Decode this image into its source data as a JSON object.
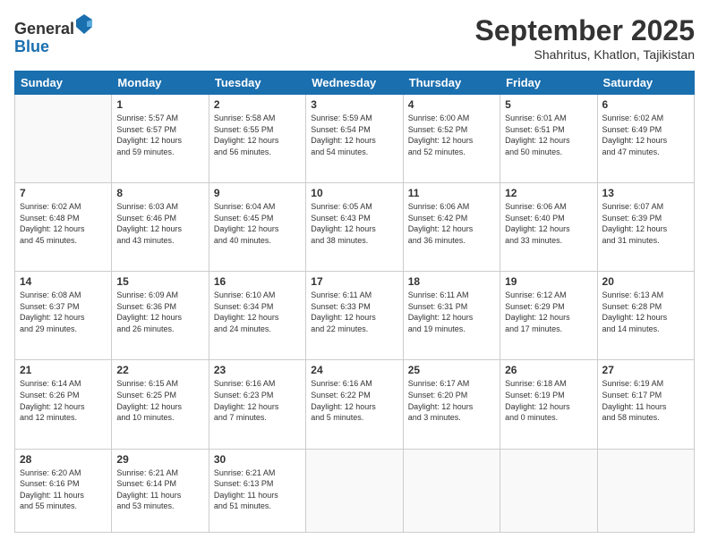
{
  "header": {
    "logo_line1": "General",
    "logo_line2": "Blue",
    "month": "September 2025",
    "location": "Shahritus, Khatlon, Tajikistan"
  },
  "weekdays": [
    "Sunday",
    "Monday",
    "Tuesday",
    "Wednesday",
    "Thursday",
    "Friday",
    "Saturday"
  ],
  "weeks": [
    [
      {
        "day": "",
        "info": ""
      },
      {
        "day": "1",
        "info": "Sunrise: 5:57 AM\nSunset: 6:57 PM\nDaylight: 12 hours\nand 59 minutes."
      },
      {
        "day": "2",
        "info": "Sunrise: 5:58 AM\nSunset: 6:55 PM\nDaylight: 12 hours\nand 56 minutes."
      },
      {
        "day": "3",
        "info": "Sunrise: 5:59 AM\nSunset: 6:54 PM\nDaylight: 12 hours\nand 54 minutes."
      },
      {
        "day": "4",
        "info": "Sunrise: 6:00 AM\nSunset: 6:52 PM\nDaylight: 12 hours\nand 52 minutes."
      },
      {
        "day": "5",
        "info": "Sunrise: 6:01 AM\nSunset: 6:51 PM\nDaylight: 12 hours\nand 50 minutes."
      },
      {
        "day": "6",
        "info": "Sunrise: 6:02 AM\nSunset: 6:49 PM\nDaylight: 12 hours\nand 47 minutes."
      }
    ],
    [
      {
        "day": "7",
        "info": "Sunrise: 6:02 AM\nSunset: 6:48 PM\nDaylight: 12 hours\nand 45 minutes."
      },
      {
        "day": "8",
        "info": "Sunrise: 6:03 AM\nSunset: 6:46 PM\nDaylight: 12 hours\nand 43 minutes."
      },
      {
        "day": "9",
        "info": "Sunrise: 6:04 AM\nSunset: 6:45 PM\nDaylight: 12 hours\nand 40 minutes."
      },
      {
        "day": "10",
        "info": "Sunrise: 6:05 AM\nSunset: 6:43 PM\nDaylight: 12 hours\nand 38 minutes."
      },
      {
        "day": "11",
        "info": "Sunrise: 6:06 AM\nSunset: 6:42 PM\nDaylight: 12 hours\nand 36 minutes."
      },
      {
        "day": "12",
        "info": "Sunrise: 6:06 AM\nSunset: 6:40 PM\nDaylight: 12 hours\nand 33 minutes."
      },
      {
        "day": "13",
        "info": "Sunrise: 6:07 AM\nSunset: 6:39 PM\nDaylight: 12 hours\nand 31 minutes."
      }
    ],
    [
      {
        "day": "14",
        "info": "Sunrise: 6:08 AM\nSunset: 6:37 PM\nDaylight: 12 hours\nand 29 minutes."
      },
      {
        "day": "15",
        "info": "Sunrise: 6:09 AM\nSunset: 6:36 PM\nDaylight: 12 hours\nand 26 minutes."
      },
      {
        "day": "16",
        "info": "Sunrise: 6:10 AM\nSunset: 6:34 PM\nDaylight: 12 hours\nand 24 minutes."
      },
      {
        "day": "17",
        "info": "Sunrise: 6:11 AM\nSunset: 6:33 PM\nDaylight: 12 hours\nand 22 minutes."
      },
      {
        "day": "18",
        "info": "Sunrise: 6:11 AM\nSunset: 6:31 PM\nDaylight: 12 hours\nand 19 minutes."
      },
      {
        "day": "19",
        "info": "Sunrise: 6:12 AM\nSunset: 6:29 PM\nDaylight: 12 hours\nand 17 minutes."
      },
      {
        "day": "20",
        "info": "Sunrise: 6:13 AM\nSunset: 6:28 PM\nDaylight: 12 hours\nand 14 minutes."
      }
    ],
    [
      {
        "day": "21",
        "info": "Sunrise: 6:14 AM\nSunset: 6:26 PM\nDaylight: 12 hours\nand 12 minutes."
      },
      {
        "day": "22",
        "info": "Sunrise: 6:15 AM\nSunset: 6:25 PM\nDaylight: 12 hours\nand 10 minutes."
      },
      {
        "day": "23",
        "info": "Sunrise: 6:16 AM\nSunset: 6:23 PM\nDaylight: 12 hours\nand 7 minutes."
      },
      {
        "day": "24",
        "info": "Sunrise: 6:16 AM\nSunset: 6:22 PM\nDaylight: 12 hours\nand 5 minutes."
      },
      {
        "day": "25",
        "info": "Sunrise: 6:17 AM\nSunset: 6:20 PM\nDaylight: 12 hours\nand 3 minutes."
      },
      {
        "day": "26",
        "info": "Sunrise: 6:18 AM\nSunset: 6:19 PM\nDaylight: 12 hours\nand 0 minutes."
      },
      {
        "day": "27",
        "info": "Sunrise: 6:19 AM\nSunset: 6:17 PM\nDaylight: 11 hours\nand 58 minutes."
      }
    ],
    [
      {
        "day": "28",
        "info": "Sunrise: 6:20 AM\nSunset: 6:16 PM\nDaylight: 11 hours\nand 55 minutes."
      },
      {
        "day": "29",
        "info": "Sunrise: 6:21 AM\nSunset: 6:14 PM\nDaylight: 11 hours\nand 53 minutes."
      },
      {
        "day": "30",
        "info": "Sunrise: 6:21 AM\nSunset: 6:13 PM\nDaylight: 11 hours\nand 51 minutes."
      },
      {
        "day": "",
        "info": ""
      },
      {
        "day": "",
        "info": ""
      },
      {
        "day": "",
        "info": ""
      },
      {
        "day": "",
        "info": ""
      }
    ]
  ]
}
